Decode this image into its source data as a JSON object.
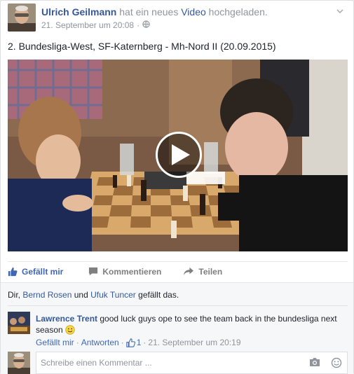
{
  "post": {
    "actor_name": "Ulrich Geilmann",
    "action_text_pre": "hat ein neues",
    "action_link": "Video",
    "action_text_post": "hochgeladen.",
    "timestamp": "21. September um 20:08",
    "separator": "·",
    "privacy_icon": "globe-icon",
    "text": "2. Bundesliga-West, SF-Katernberg - Mh-Nord II (20.09.2015)"
  },
  "actions": {
    "like": "Gefällt mir",
    "comment": "Kommentieren",
    "share": "Teilen"
  },
  "likes_summary": {
    "prefix": "Dir,",
    "person1": "Bernd Rosen",
    "conj": "und",
    "person2": "Ufuk Tuncer",
    "suffix": "gefällt das."
  },
  "comments": [
    {
      "author": "Lawrence Trent",
      "text": "good luck guys ope to see the team back in the bundesliga next season",
      "emoji": "smile-emoji",
      "like_label": "Gefällt mir",
      "reply_label": "Antworten",
      "like_count": "1",
      "timestamp": "21. September um 20:19",
      "sep": "·"
    }
  ],
  "composer": {
    "placeholder": "Schreibe einen Kommentar ..."
  },
  "colors": {
    "link": "#365899",
    "accent": "#4267b2",
    "muted": "#90949c"
  }
}
